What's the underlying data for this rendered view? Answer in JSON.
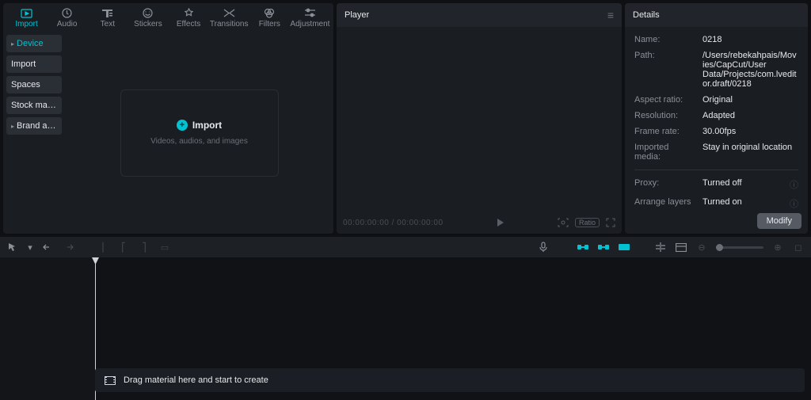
{
  "top_tabs": [
    {
      "name": "import",
      "label": "Import",
      "icon": "import-icon",
      "active": true
    },
    {
      "name": "audio",
      "label": "Audio",
      "icon": "audio-icon"
    },
    {
      "name": "text",
      "label": "Text",
      "icon": "text-icon"
    },
    {
      "name": "stickers",
      "label": "Stickers",
      "icon": "stickers-icon"
    },
    {
      "name": "effects",
      "label": "Effects",
      "icon": "effects-icon"
    },
    {
      "name": "transitions",
      "label": "Transitions",
      "icon": "transitions-icon"
    },
    {
      "name": "filters",
      "label": "Filters",
      "icon": "filters-icon"
    },
    {
      "name": "adjustment",
      "label": "Adjustment",
      "icon": "adjustment-icon"
    }
  ],
  "side_items": [
    {
      "name": "device",
      "label": "Device",
      "active": true,
      "expandable": true
    },
    {
      "name": "import",
      "label": "Import"
    },
    {
      "name": "spaces",
      "label": "Spaces"
    },
    {
      "name": "stock",
      "label": "Stock mate..."
    },
    {
      "name": "brand",
      "label": "Brand assets",
      "expandable": true
    }
  ],
  "import_box": {
    "title": "Import",
    "subtitle": "Videos, audios, and images"
  },
  "player": {
    "title": "Player",
    "time_current": "00:00:00:00",
    "time_total": "00:00:00:00",
    "ratio_label": "Ratio"
  },
  "details": {
    "title": "Details",
    "rows": [
      {
        "label": "Name:",
        "value": "0218"
      },
      {
        "label": "Path:",
        "value": "/Users/rebekahpais/Movies/CapCut/User Data/Projects/com.lveditor.draft/0218"
      },
      {
        "label": "Aspect ratio:",
        "value": "Original"
      },
      {
        "label": "Resolution:",
        "value": "Adapted"
      },
      {
        "label": "Frame rate:",
        "value": "30.00fps"
      },
      {
        "label": "Imported media:",
        "value": "Stay in original location"
      }
    ],
    "extra": [
      {
        "label": "Proxy:",
        "value": "Turned off",
        "hint": true
      },
      {
        "label": "Arrange layers",
        "value": "Turned on",
        "hint": true
      }
    ],
    "modify": "Modify"
  },
  "drag_hint": "Drag material here and start to create"
}
